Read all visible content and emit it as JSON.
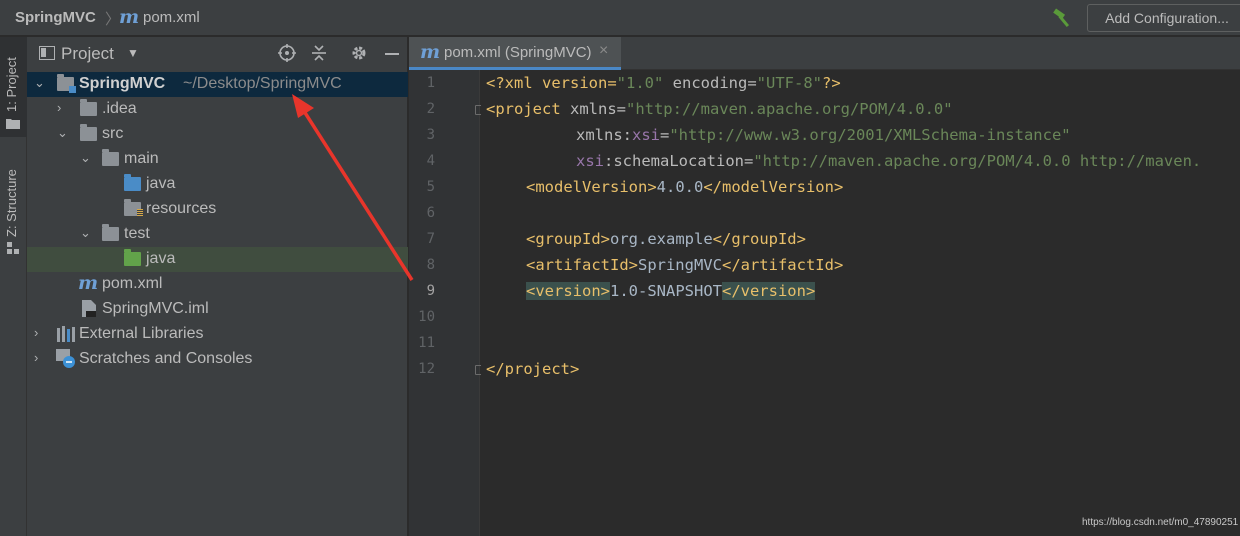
{
  "breadcrumb": {
    "project": "SpringMVC",
    "separator": "〉",
    "file_icon": "m",
    "file": "pom.xml"
  },
  "toolbar": {
    "run_config_label": "Add Configuration...",
    "build_icon": "hammer-icon"
  },
  "side_strip": {
    "project_tab": "1: Project",
    "structure_tab": "Z: Structure"
  },
  "project_panel": {
    "title": "Project",
    "tools": [
      "locate-icon",
      "collapse-all-icon",
      "gear-icon",
      "minimize-icon"
    ],
    "tree": [
      {
        "label": "SpringMVC",
        "hint": "~/Desktop/SpringMVC",
        "icon": "module-folder-icon",
        "expanded": true,
        "selected": true
      },
      {
        "label": ".idea",
        "icon": "folder-icon",
        "expanded": false
      },
      {
        "label": "src",
        "icon": "folder-icon",
        "expanded": true
      },
      {
        "label": "main",
        "icon": "folder-icon",
        "expanded": true
      },
      {
        "label": "java",
        "icon": "source-folder-icon"
      },
      {
        "label": "resources",
        "icon": "resources-folder-icon"
      },
      {
        "label": "test",
        "icon": "folder-icon",
        "expanded": true
      },
      {
        "label": "java",
        "icon": "test-source-folder-icon",
        "highlighted": true
      },
      {
        "label": "pom.xml",
        "icon": "maven-icon"
      },
      {
        "label": "SpringMVC.iml",
        "icon": "iml-file-icon"
      },
      {
        "label": "External Libraries",
        "icon": "libraries-icon",
        "expanded": false
      },
      {
        "label": "Scratches and Consoles",
        "icon": "scratches-icon",
        "expanded": false
      }
    ]
  },
  "editor": {
    "tab": {
      "icon": "m",
      "label": "pom.xml (SpringMVC)",
      "close": "×"
    },
    "current_line": 9,
    "line_numbers": [
      "1",
      "2",
      "3",
      "4",
      "5",
      "6",
      "7",
      "8",
      "9",
      "10",
      "11",
      "12"
    ],
    "code": {
      "l1": {
        "a": "<?xml version=",
        "b": "\"1.0\"",
        "c": " encoding=",
        "d": "\"UTF-8\"",
        "e": "?>"
      },
      "l2": {
        "a": "<project",
        "b": " xmlns=",
        "c": "\"http://maven.apache.org/POM/4.0.0\""
      },
      "l3": {
        "a": "xmlns:",
        "b": "xsi",
        "c": "=",
        "d": "\"http://www.w3.org/2001/XMLSchema-instance\""
      },
      "l4": {
        "a": "xsi",
        "b": ":schemaLocation=",
        "c": "\"http://maven.apache.org/POM/4.0.0 http://maven."
      },
      "l5": {
        "a": "<modelVersion>",
        "b": "4.0.0",
        "c": "</modelVersion>"
      },
      "l7": {
        "a": "<groupId>",
        "b": "org.example",
        "c": "</groupId>"
      },
      "l8": {
        "a": "<artifactId>",
        "b": "SpringMVC",
        "c": "</artifactId>"
      },
      "l9": {
        "a": "<version>",
        "b": "1.0-SNAPSHOT",
        "c": "</version>"
      },
      "l12": {
        "a": "</project>"
      }
    }
  },
  "colors": {
    "annotation_arrow": "#e8352b",
    "accent": "#4a88c7"
  },
  "watermark": "https://blog.csdn.net/m0_47890251"
}
